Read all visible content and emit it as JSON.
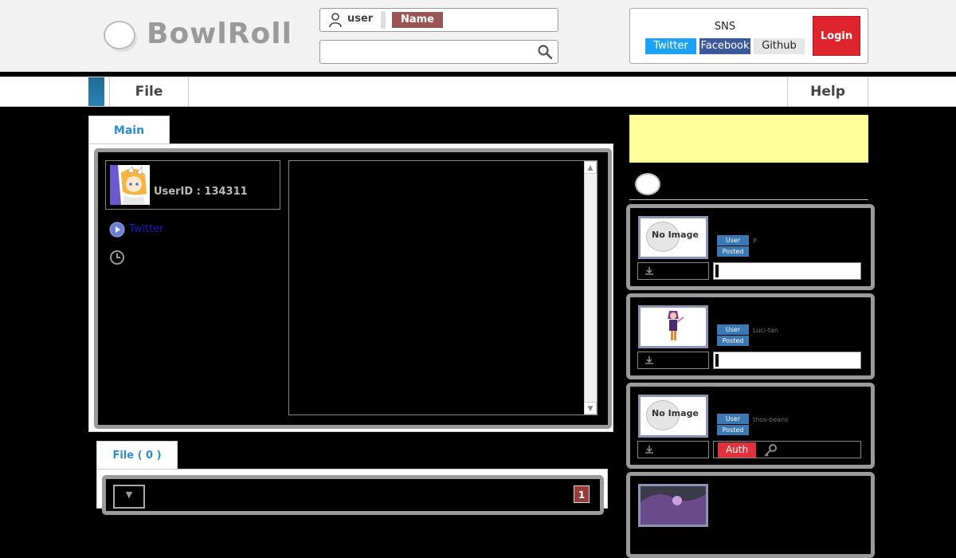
{
  "header": {
    "logo_text": "BowlRoll",
    "user_label": "user",
    "name_label": "Name",
    "search": {
      "value": "",
      "placeholder": ""
    },
    "sns": {
      "title": "SNS",
      "buttons": [
        "Twitter",
        "Facebook",
        "Github"
      ]
    },
    "login_label": "Login"
  },
  "menu": {
    "file": "File",
    "help": "Help"
  },
  "main": {
    "tab_label": "Main",
    "user_id": "UserID : 134311",
    "twitter_link": "Twitter"
  },
  "files": {
    "tab_label": "File ( 0 )",
    "page": "1"
  },
  "sidebar": {
    "posts": [
      {
        "thumb": "No Image",
        "tag_user": "User",
        "tag_posted": "Posted",
        "username": "P",
        "progress": 0.02
      },
      {
        "thumb": "image",
        "tag_user": "User",
        "tag_posted": "Posted",
        "username": "Luci-tan",
        "progress": 0.02
      },
      {
        "thumb": "No Image",
        "tag_user": "User",
        "tag_posted": "Posted",
        "username": "thos-beans",
        "auth_label": "Auth"
      }
    ]
  },
  "colors": {
    "accent_blue": "#2d8bd1",
    "login_red": "#e0242e",
    "name_tag": "#9a5454",
    "ad_yellow": "#ffff99",
    "twitter": "#1da1f2",
    "facebook": "#3b5998"
  }
}
